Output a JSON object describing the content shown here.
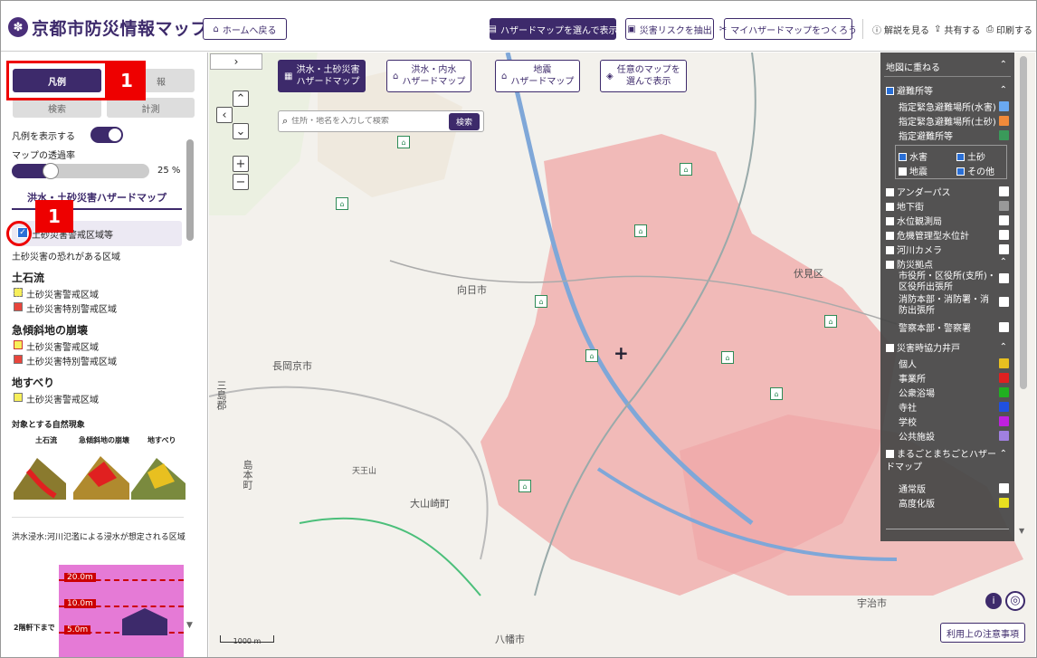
{
  "header": {
    "logo_char": "✽",
    "title": "京都市防災情報マップ",
    "home_button": "ホームへ戻る",
    "select_hazard_button": "ハザードマップを選んで表示",
    "extract_risk_button": "災害リスクを抽出",
    "my_hazard_button": "マイハザードマップをつくろう",
    "help_link": "解説を見る",
    "share_link": "共有する",
    "print_link": "印刷する"
  },
  "left_panel": {
    "tabs": {
      "legend": "凡例",
      "info": "報",
      "search": "検索",
      "measure": "計測"
    },
    "annotation_number": "1",
    "show_legend_label": "凡例を表示する",
    "opacity_label": "マップの透過率",
    "opacity_value": 0.25,
    "opacity_text": "25 %",
    "section_title": "洪水・土砂災害ハザードマップ",
    "checkbox_label": "土砂災害警戒区域等",
    "sediment_note": "土砂災害の恐れがある区域",
    "debris_flow": {
      "heading": "土石流",
      "items": [
        "土砂災害警戒区域",
        "土砂災害特別警戒区域"
      ]
    },
    "steep_slope": {
      "heading": "急傾斜地の崩壊",
      "items": [
        "土砂災害警戒区域",
        "土砂災害特別警戒区域"
      ]
    },
    "landslide": {
      "heading": "地すべり",
      "items": [
        "土砂災害警戒区域"
      ]
    },
    "phenomena_heading": "対象とする自然現象",
    "phenomena": [
      "土石流",
      "急傾斜地の崩壊",
      "地すべり"
    ],
    "flood_note": "洪水浸水:河川氾濫による浸水が想定される区域",
    "depth_levels": [
      "20.0m",
      "10.0m",
      "5.0m"
    ],
    "depth_note": "2階軒下まで",
    "colors": {
      "caution": "#f7ef5a",
      "special": "#e8453c",
      "flood": "#e57ad6"
    }
  },
  "map": {
    "tabs": [
      {
        "label1": "洪水・土砂災害",
        "label2": "ハザードマップ",
        "active": true
      },
      {
        "label1": "洪水・内水",
        "label2": "ハザードマップ",
        "active": false
      },
      {
        "label1": "地震",
        "label2": "ハザードマップ",
        "active": false
      },
      {
        "label1": "任意のマップを",
        "label2": "選んで表示",
        "active": false
      }
    ],
    "search_placeholder": "住所・地名を入力して検索",
    "search_button": "検索",
    "expand_arrow": "›",
    "place_labels": {
      "nagaokakyo": "長岡京市",
      "mishima": "三島郡",
      "shimamoto": "島本町",
      "oyamazaki": "大山崎町",
      "uji": "宇治市",
      "mukou": "向日市",
      "fushimi": "伏見区",
      "yawata": "八幡市",
      "tennozan": "天王山"
    },
    "scale": "1000 m",
    "notice_button": "利用上の注意事項"
  },
  "overlay": {
    "title": "地図に重ねる",
    "evacuation": "避難所等",
    "items": [
      "指定緊急避難場所(水害)",
      "指定緊急避難場所(土砂)",
      "指定避難所等"
    ],
    "filter": {
      "flood": "水害",
      "sediment": "土砂",
      "earthquake": "地震",
      "other": "その他"
    },
    "layers": [
      "アンダーパス",
      "地下街",
      "水位観測局",
      "危機管理型水位計",
      "河川カメラ"
    ],
    "disaster_base": "防災拠点",
    "bases": [
      "市役所・区役所(支所)・区役所出張所",
      "消防本部・消防署・消防出張所",
      "警察本部・警察署"
    ],
    "wells": "災害時協力井戸",
    "well_items": [
      "個人",
      "事業所",
      "公衆浴場",
      "寺社",
      "学校",
      "公共施設"
    ],
    "town_hazard": "まるごとまちごとハザードマップ",
    "town_items": [
      "通常版",
      "高度化版"
    ]
  }
}
